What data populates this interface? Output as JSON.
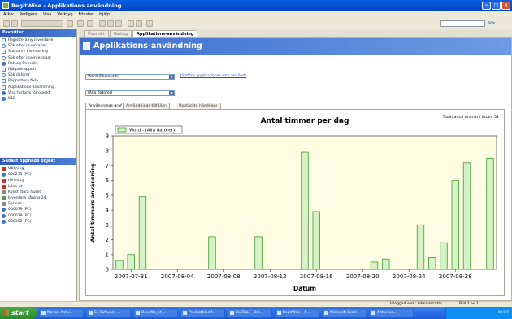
{
  "window": {
    "title": "RegitWise - Applikations användning"
  },
  "menu": [
    "Arkiv",
    "Redigera",
    "Visa",
    "Verktyg",
    "Fönster",
    "Hjälp"
  ],
  "toolbar": {
    "search_label": "Sök"
  },
  "page_tabs": [
    {
      "label": "Översikt",
      "active": false
    },
    {
      "label": "RetLog",
      "active": false
    },
    {
      "label": "Applikations-användning",
      "active": true
    }
  ],
  "sidebar": {
    "favorites_title": "Favoriter",
    "favorites": [
      {
        "label": "Registrera ny inventarie",
        "icon": "doc-icon"
      },
      {
        "label": "Sök efter inventarier",
        "icon": "search-icon"
      },
      {
        "label": "Starta ny inventering",
        "icon": "doc-icon"
      },
      {
        "label": "Sök efter inventeringar",
        "icon": "search-icon"
      },
      {
        "label": "RetLog Översikt",
        "icon": "globe-icon"
      },
      {
        "label": "Hjälpverapport",
        "icon": "doc-icon"
      },
      {
        "label": "Sök datorer",
        "icon": "search-icon"
      },
      {
        "label": "Rapportera fixla",
        "icon": "doc-icon"
      },
      {
        "label": "Applikations-användning",
        "icon": "doc-icon"
      },
      {
        "label": "Visa historik för objekt",
        "icon": "globe-icon"
      },
      {
        "label": "K12",
        "icon": "globe-icon"
      }
    ],
    "recent_title": "Senast öppnade objekt",
    "recent": [
      {
        "label": "Utlåning",
        "icon": "red"
      },
      {
        "label": "000271 (PC)",
        "icon": "blue"
      },
      {
        "label": "Utlåning",
        "icon": "red"
      },
      {
        "label": "Låna ut",
        "icon": "red"
      },
      {
        "label": "Konst stora huset",
        "icon": "gray"
      },
      {
        "label": "Inventera våning 24",
        "icon": "green"
      },
      {
        "label": "Service",
        "icon": "gray"
      },
      {
        "label": "000079 (PC)",
        "icon": "blue"
      },
      {
        "label": "000079 (PC)",
        "icon": "blue"
      },
      {
        "label": "000382 (PC)",
        "icon": "blue"
      }
    ]
  },
  "main": {
    "title": "Applikations-användning",
    "software_select": "Word (Microsoft)",
    "compare_link": "Jämföra applikationer som används",
    "computer_select": "(Alla datorer)",
    "tabs": [
      {
        "label": "Användnings-graf",
        "active": true
      },
      {
        "label": "Användnings-tillfällen",
        "active": false
      },
      {
        "label": "Upptäckta händelser",
        "active": false
      }
    ],
    "total_label": "Totalt antal timmar i listan: 51"
  },
  "chart_data": {
    "type": "bar",
    "title": "Antal timmar per dag",
    "xlabel": "Datum",
    "ylabel": "Antal timmars användning",
    "legend": "Word - (Alla datorer)",
    "legend_position": "top-left",
    "ylim": [
      0,
      9
    ],
    "yticks": [
      0,
      1,
      2,
      3,
      4,
      5,
      6,
      7,
      8,
      9
    ],
    "x_ticks": [
      "2007-07-31",
      "2007-08-04",
      "2007-08-08",
      "2007-08-12",
      "2007-08-16",
      "2007-08-20",
      "2007-08-24",
      "2007-08-28"
    ],
    "x_start": "2007-07-30",
    "x_end": "2007-08-31",
    "points": [
      {
        "date": "2007-07-30",
        "value": 0.6
      },
      {
        "date": "2007-07-31",
        "value": 1.0
      },
      {
        "date": "2007-08-01",
        "value": 4.9
      },
      {
        "date": "2007-08-07",
        "value": 2.2
      },
      {
        "date": "2007-08-11",
        "value": 2.2
      },
      {
        "date": "2007-08-15",
        "value": 7.9
      },
      {
        "date": "2007-08-16",
        "value": 3.9
      },
      {
        "date": "2007-08-21",
        "value": 0.5
      },
      {
        "date": "2007-08-22",
        "value": 0.7
      },
      {
        "date": "2007-08-25",
        "value": 3.0
      },
      {
        "date": "2007-08-26",
        "value": 0.8
      },
      {
        "date": "2007-08-27",
        "value": 1.8
      },
      {
        "date": "2007-08-28",
        "value": 6.0
      },
      {
        "date": "2007-08-29",
        "value": 7.2
      },
      {
        "date": "2007-08-31",
        "value": 7.5
      }
    ],
    "grid": false,
    "colors": {
      "bar_fill": "#d5f3c4",
      "bar_stroke": "#3c9a2e",
      "plot_bg": "#fffde3"
    }
  },
  "status": {
    "left": "Inloggad som: Administratör",
    "right": "Bild 1 av 1"
  },
  "taskbar": {
    "start": "start",
    "items": [
      "Norton Antiv...",
      "Ex Software ...",
      "Benefits_of_...",
      "Produktblad f...",
      "YouTube - Bro...",
      "RegitWise - A...",
      "Microsoft Excel",
      "Antivirus..."
    ],
    "clock": "09:27"
  }
}
